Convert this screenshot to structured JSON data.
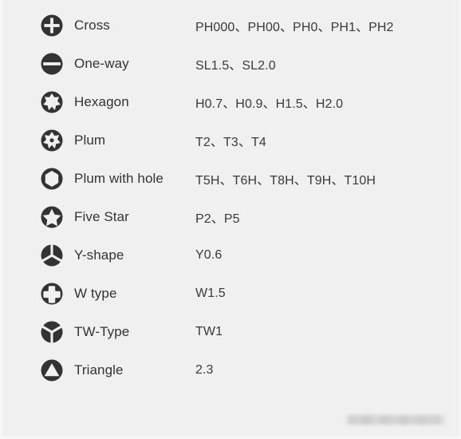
{
  "page": {
    "background_color": "#f0f0f0",
    "label_text_color": "#333333",
    "value_text_color": "#3a3a3a",
    "icon_color": "#333333"
  },
  "spec_list": {
    "rows": [
      {
        "icon": "cross-bit-icon",
        "label": "Cross",
        "value": "PH000、PH00、PH0、PH1、PH2"
      },
      {
        "icon": "one-way-slot-bit-icon",
        "label": "One-way",
        "value": "SL1.5、SL2.0"
      },
      {
        "icon": "hexagon-star-bit-icon",
        "label": "Hexagon",
        "value": "H0.7、H0.9、H1.5、H2.0"
      },
      {
        "icon": "plum-torx-bit-icon",
        "label": "Plum",
        "value": "T2、T3、T4"
      },
      {
        "icon": "plum-with-hole-bit-icon",
        "label": "Plum with hole",
        "value": "T5H、T6H、T8H、T9H、T10H"
      },
      {
        "icon": "five-star-bit-icon",
        "label": "Five Star",
        "value": "P2、P5"
      },
      {
        "icon": "y-shape-bit-icon",
        "label": "Y-shape",
        "value": "Y0.6"
      },
      {
        "icon": "w-type-bit-icon",
        "label": "W type",
        "value": "W1.5"
      },
      {
        "icon": "tw-type-bit-icon",
        "label": "TW-Type",
        "value": "TW1"
      },
      {
        "icon": "triangle-bit-icon",
        "label": "Triangle",
        "value": "2.3"
      }
    ]
  },
  "watermark": {
    "text": ""
  }
}
